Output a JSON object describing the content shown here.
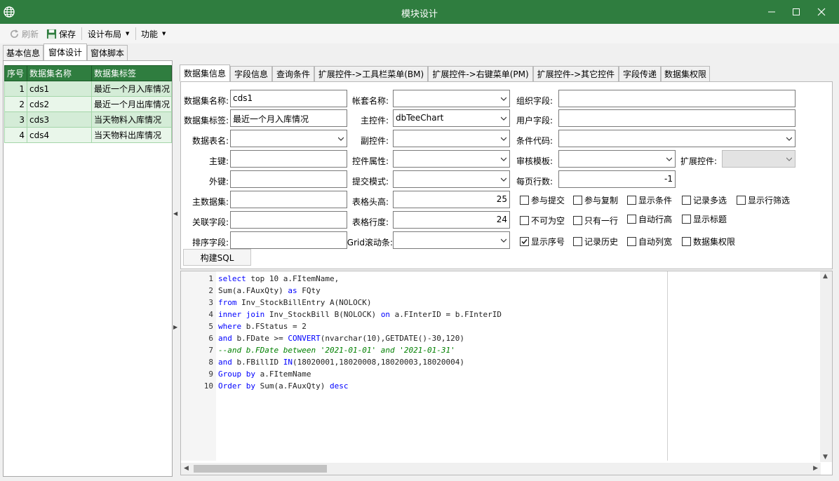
{
  "window": {
    "title": "模块设计",
    "app_icon": "globe-icon",
    "controls": [
      "minimize-icon",
      "maximize-icon",
      "close-icon"
    ],
    "accent_color": "#2f7d3f"
  },
  "toolbar": {
    "refresh_label": "刷新",
    "save_label": "保存",
    "layout_label": "设计布局",
    "function_label": "功能"
  },
  "outer_tabs": [
    "基本信息",
    "窗体设计",
    "窗体脚本"
  ],
  "dataset_grid": {
    "headers": [
      "序号",
      "数据集名称",
      "数据集标签"
    ],
    "rows": [
      {
        "no": "1",
        "name": "cds1",
        "label": "最近一个月入库情况"
      },
      {
        "no": "2",
        "name": "cds2",
        "label": "最近一个月出库情况"
      },
      {
        "no": "3",
        "name": "cds3",
        "label": "当天物料入库情况"
      },
      {
        "no": "4",
        "name": "cds4",
        "label": "当天物料出库情况"
      }
    ]
  },
  "inner_tabs": [
    "数据集信息",
    "字段信息",
    "查询条件",
    "扩展控件->工具栏菜单(BM)",
    "扩展控件->右键菜单(PM)",
    "扩展控件->其它控件",
    "字段传递",
    "数据集权限"
  ],
  "form": {
    "dataset_name": {
      "label": "数据集名称:",
      "value": "cds1"
    },
    "dataset_label": {
      "label": "数据集标签:",
      "value": "最近一个月入库情况"
    },
    "table_name": {
      "label": "数据表名:",
      "value": ""
    },
    "primary_key": {
      "label": "主键:",
      "value": ""
    },
    "foreign_key": {
      "label": "外键:",
      "value": ""
    },
    "master_dataset": {
      "label": "主数据集:",
      "value": ""
    },
    "link_field": {
      "label": "关联字段:",
      "value": ""
    },
    "sort_field": {
      "label": "排序字段:",
      "value": ""
    },
    "account_name": {
      "label": "帐套名称:",
      "value": ""
    },
    "main_control": {
      "label": "主控件:",
      "value": "dbTeeChart"
    },
    "sub_control": {
      "label": "副控件:",
      "value": ""
    },
    "control_props": {
      "label": "控件属性:",
      "value": ""
    },
    "submit_mode": {
      "label": "提交模式:",
      "value": ""
    },
    "header_height": {
      "label": "表格头高:",
      "value": "25"
    },
    "row_height": {
      "label": "表格行度:",
      "value": "24"
    },
    "grid_scrollbar": {
      "label": "Grid滚动条:",
      "value": ""
    },
    "org_field": {
      "label": "组织字段:",
      "value": ""
    },
    "user_field": {
      "label": "用户字段:",
      "value": ""
    },
    "condition_code": {
      "label": "条件代码:",
      "value": ""
    },
    "audit_template": {
      "label": "审核模板:",
      "value": ""
    },
    "ext_control": {
      "label": "扩展控件:",
      "value": ""
    },
    "page_rows": {
      "label": "每页行数:",
      "value": "-1"
    }
  },
  "checkboxes": [
    [
      {
        "label": "参与提交",
        "checked": false
      },
      {
        "label": "参与复制",
        "checked": false
      },
      {
        "label": "显示条件",
        "checked": false
      },
      {
        "label": "记录多选",
        "checked": false
      },
      {
        "label": "显示行筛选",
        "checked": false
      }
    ],
    [
      {
        "label": "不可为空",
        "checked": false
      },
      {
        "label": "只有一行",
        "checked": false
      },
      {
        "label": "自动行高",
        "checked": false
      },
      {
        "label": "显示标题",
        "checked": false
      }
    ],
    [
      {
        "label": "显示序号",
        "checked": true
      },
      {
        "label": "记录历史",
        "checked": false
      },
      {
        "label": "自动列宽",
        "checked": false
      },
      {
        "label": "数据集权限",
        "checked": false
      }
    ]
  ],
  "build_sql_label": "构建SQL",
  "sql_lines": [
    [
      {
        "t": "select",
        "k": 1
      },
      {
        "t": " top 10 a.FItemName,"
      }
    ],
    [
      {
        "t": "Sum(a.FAuxQty) "
      },
      {
        "t": "as",
        "k": 1
      },
      {
        "t": " FQty"
      }
    ],
    [
      {
        "t": "from",
        "k": 1
      },
      {
        "t": " Inv_StockBillEntry A(NOLOCK)"
      }
    ],
    [
      {
        "t": "inner join",
        "k": 1
      },
      {
        "t": " Inv_StockBill B(NOLOCK) "
      },
      {
        "t": "on",
        "k": 1
      },
      {
        "t": " a.FInterID = b.FInterID"
      }
    ],
    [
      {
        "t": "where",
        "k": 1
      },
      {
        "t": " b.FStatus = 2"
      }
    ],
    [
      {
        "t": "and",
        "k": 1
      },
      {
        "t": " b.FDate >= "
      },
      {
        "t": "CONVERT",
        "k": 1
      },
      {
        "t": "(nvarchar(10),GETDATE()-30,120)"
      }
    ],
    [
      {
        "t": "--and b.FDate between '2021-01-01' and '2021-01-31'",
        "c": 1
      }
    ],
    [
      {
        "t": "and",
        "k": 1
      },
      {
        "t": " b.FBillID "
      },
      {
        "t": "IN",
        "k": 1
      },
      {
        "t": "(18020001,18020008,18020003,18020004)"
      }
    ],
    [
      {
        "t": "Group by",
        "k": 1
      },
      {
        "t": " a.FItemName"
      }
    ],
    [
      {
        "t": "Order by",
        "k": 1
      },
      {
        "t": " Sum(a.FAuxQty) "
      },
      {
        "t": "desc",
        "k": 1
      }
    ]
  ],
  "line_numbers": [
    "1",
    "2",
    "3",
    "4",
    "5",
    "6",
    "7",
    "8",
    "9",
    "10"
  ]
}
